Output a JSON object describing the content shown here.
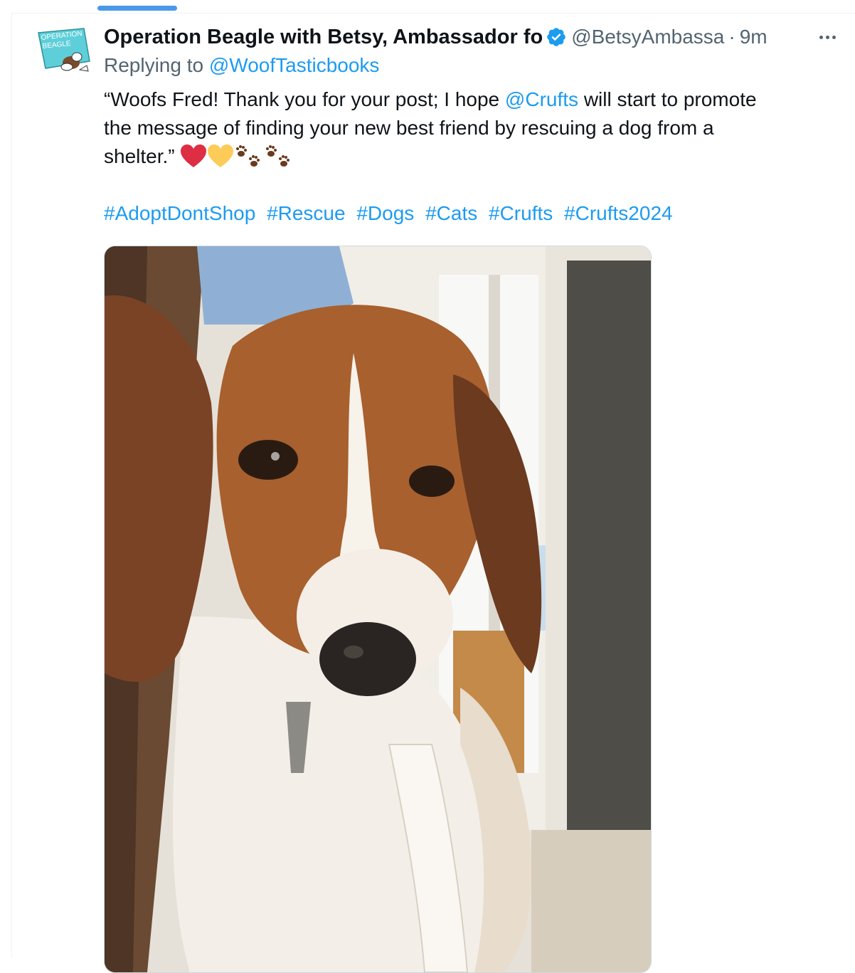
{
  "tweet": {
    "display_name": "Operation Beagle with Betsy, Ambassador fo",
    "handle": "@BetsyAmbassa",
    "separator": "·",
    "time": "9m",
    "replying_prefix": "Replying to",
    "replying_to": "@WoofTasticbooks",
    "text": {
      "line1_a": "“Woofs Fred! Thank you for your post; I hope",
      "mention": "@Crufts",
      "line1_b": "will start to promote",
      "line2": "the message of finding your new best friend by rescuing a dog from a",
      "line3": "shelter.”"
    },
    "emojis": [
      "red-heart-icon",
      "yellow-heart-icon",
      "paw-prints-icon",
      "paw-prints-icon"
    ],
    "hashtags": [
      "#AdoptDontShop",
      "#Rescue",
      "#Dogs",
      "#Cats",
      "#Crufts",
      "#Crufts2024"
    ],
    "avatar_text": [
      "OPERATION",
      "BEAGLE"
    ]
  },
  "colors": {
    "link": "#1d9bf0",
    "text": "#0f1419",
    "secondary": "#536471",
    "tab_indicator": "#4a99e9",
    "avatar_bg": "#5ecfd9"
  }
}
